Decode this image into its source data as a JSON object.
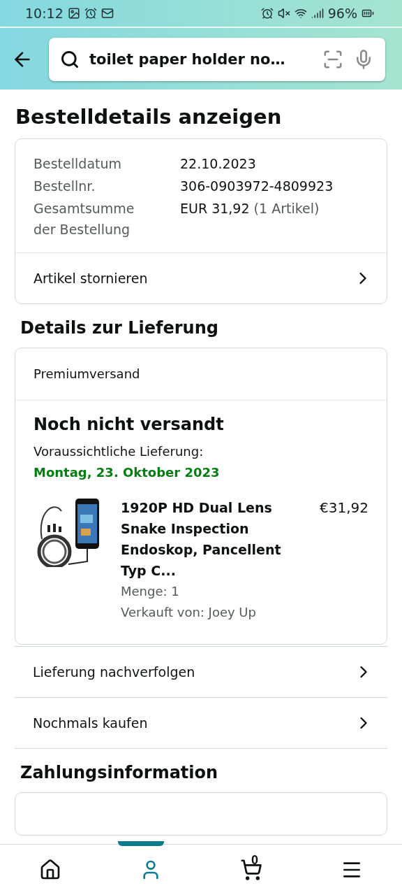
{
  "status_bar": {
    "time": "10:12",
    "battery": "96%"
  },
  "search": {
    "value": "toilet paper holder no…"
  },
  "title": "Bestelldetails anzeigen",
  "order_summary": {
    "rows": [
      {
        "label": "Bestelldatum",
        "value": "22.10.2023"
      },
      {
        "label": "Bestellnr.",
        "value": "306-0903972-4809923"
      },
      {
        "label": "Gesamtsumme der Bestellung",
        "value": "EUR 31,92",
        "note": "(1 Artikel)"
      }
    ],
    "action": "Artikel stornieren"
  },
  "delivery": {
    "heading": "Details zur Lieferung",
    "shipping": "Premiumversand",
    "status": "Noch nicht versandt",
    "eta_label": "Voraussichtliche Lieferung:",
    "eta_date": "Montag, 23. Oktober 2023",
    "item": {
      "title": "1920P HD Dual Lens Snake Inspection Endoskop, Pancellent Typ C...",
      "price": "€31,92",
      "quantity": "Menge: 1",
      "seller": "Verkauft von: Joey Up"
    }
  },
  "links": [
    "Lieferung nachverfolgen",
    "Nochmals kaufen"
  ],
  "payment": {
    "heading": "Zahlungsinformation"
  },
  "bottom_nav": [
    {
      "kind": "home",
      "selected": false
    },
    {
      "kind": "account",
      "selected": true
    },
    {
      "kind": "cart",
      "count": "0",
      "selected": false
    },
    {
      "kind": "menu",
      "selected": false
    }
  ]
}
